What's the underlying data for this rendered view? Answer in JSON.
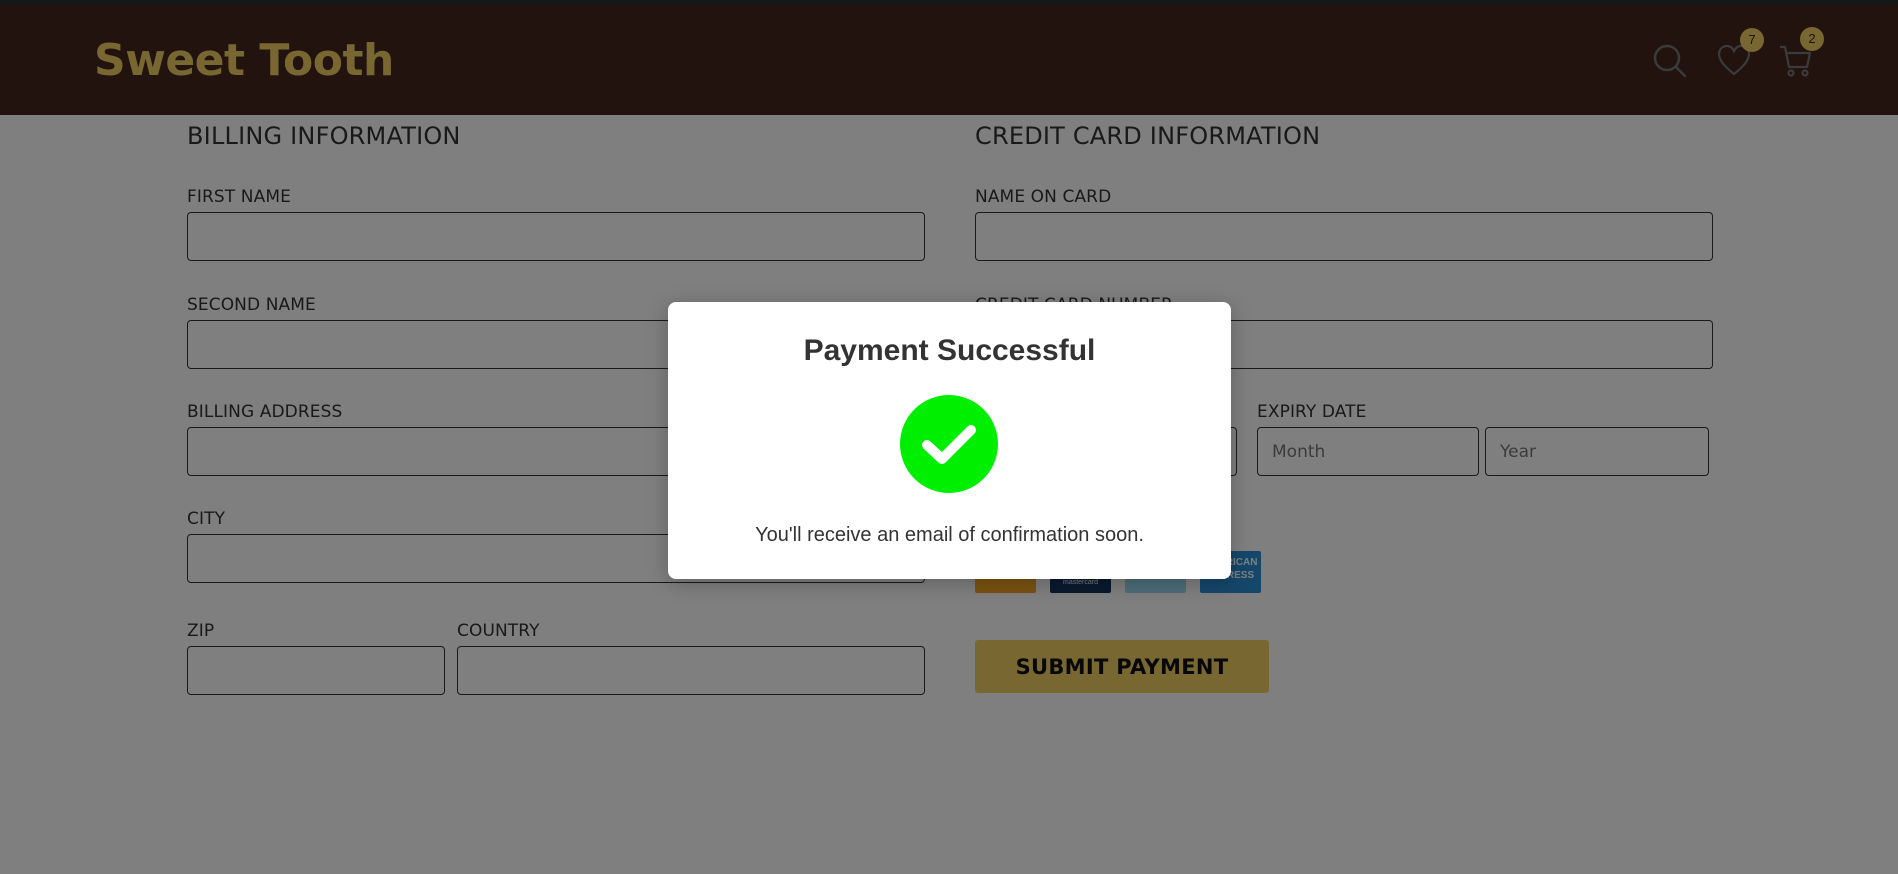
{
  "header": {
    "logo": "Sweet Tooth",
    "icons": {
      "search": "search-icon",
      "wishlist": "heart-icon",
      "cart": "cart-icon"
    },
    "wishlist_count": "7",
    "cart_count": "2",
    "colors": {
      "bar": "#44271e",
      "accent": "#f2cf62"
    }
  },
  "billing": {
    "title": "BILLING INFORMATION",
    "first_name_label": "FIRST NAME",
    "second_name_label": "SECOND NAME",
    "address_label": "BILLING ADDRESS",
    "city_label": "CITY",
    "zip_label": "ZIP",
    "country_label": "COUNTRY"
  },
  "credit": {
    "title": "CREDIT CARD INFORMATION",
    "name_label": "NAME ON CARD",
    "number_label": "CREDIT CARD NUMBER",
    "expiry_label": "EXPIRY DATE",
    "month_placeholder": "Month",
    "year_placeholder": "Year",
    "card_brands": [
      "visa",
      "mastercard",
      "paypal",
      "american-express"
    ],
    "mastercard_text": "mastercard",
    "amex_text_1": "AMERICAN",
    "amex_text_2": "EXPRESS",
    "submit_label": "SUBMIT PAYMENT"
  },
  "modal": {
    "title": "Payment Successful",
    "icon": "check-circle-icon",
    "message": "You'll receive an email of confirmation soon.",
    "success_color": "#00ee00"
  }
}
